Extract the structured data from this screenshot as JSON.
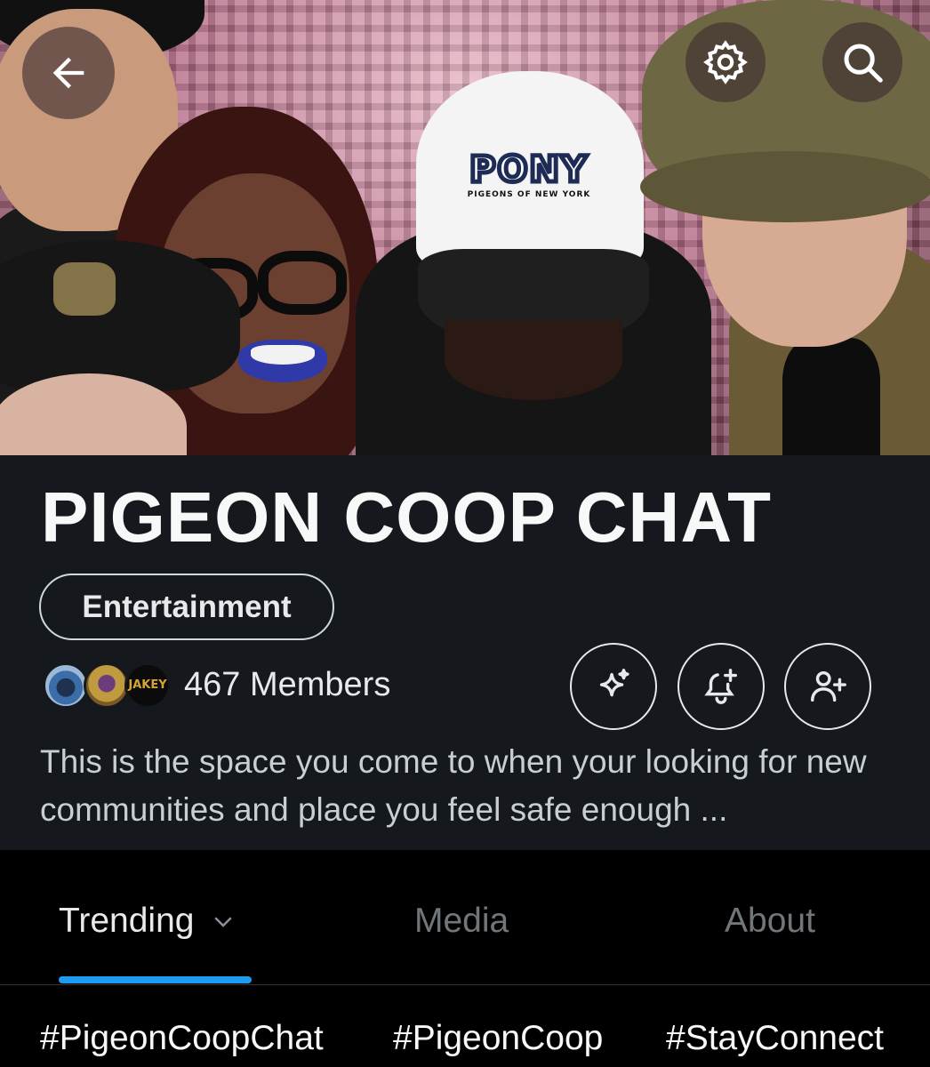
{
  "banner": {
    "cap_text": "PONY",
    "cap_subtext": "PIGEONS OF NEW YORK"
  },
  "toolbar": {
    "back_icon": "arrow-left-icon",
    "settings_icon": "gear-icon",
    "search_icon": "search-icon"
  },
  "community": {
    "title": "PIGEON COOP CHAT",
    "category": "Entertainment",
    "members_label": "467 Members",
    "avatar3_text": "JAKEY",
    "description": "This is the space you come to when your looking for new communities and place you feel safe enough ..."
  },
  "actions": {
    "spark_icon": "sparkle-icon",
    "bell_icon": "bell-plus-icon",
    "join_icon": "user-plus-icon"
  },
  "tabs": [
    {
      "label": "Trending",
      "active": true
    },
    {
      "label": "Media",
      "active": false
    },
    {
      "label": "About",
      "active": false
    }
  ],
  "hashtags": [
    "#PigeonCoopChat",
    "#PigeonCoop",
    "#StayConnect"
  ],
  "colors": {
    "accent": "#1d9bf0",
    "header_bg": "#15181c",
    "background": "#000000",
    "text": "#e7e9ea",
    "muted": "#71767b"
  }
}
